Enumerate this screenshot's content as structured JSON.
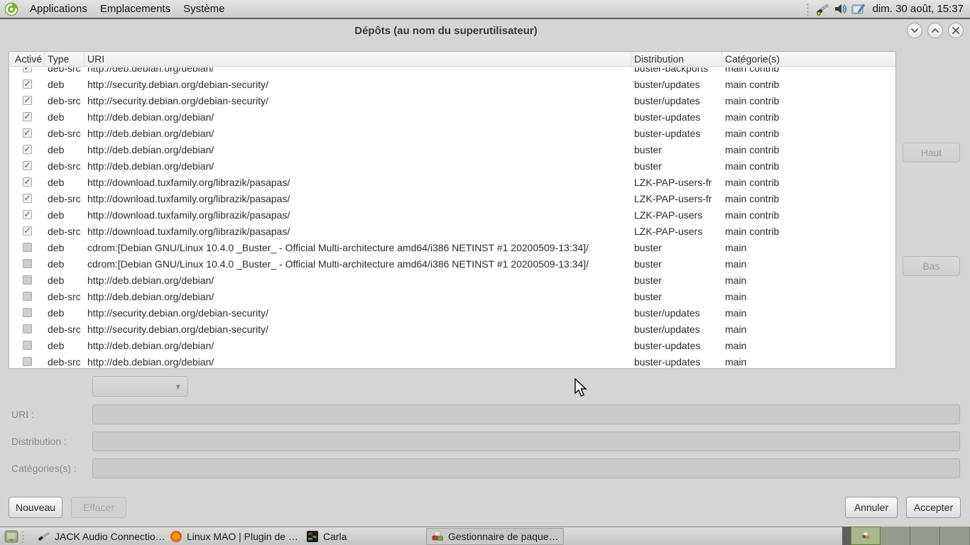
{
  "top_panel": {
    "menus": [
      {
        "label": "Applications"
      },
      {
        "label": "Emplacements"
      },
      {
        "label": "Système"
      }
    ],
    "clock": "dim. 30 août, 15:37"
  },
  "window": {
    "title": "Dépôts (au nom du superutilisateur)"
  },
  "table": {
    "columns": [
      "Activé",
      "Type",
      "URI",
      "Distribution",
      "Catégorie(s)"
    ],
    "rows": [
      {
        "enabled": true,
        "type": "deb-src",
        "uri": "http://deb.debian.org/debian/",
        "distribution": "buster-backports",
        "categories": "main contrib"
      },
      {
        "enabled": true,
        "type": "deb",
        "uri": "http://security.debian.org/debian-security/",
        "distribution": "buster/updates",
        "categories": "main contrib"
      },
      {
        "enabled": true,
        "type": "deb-src",
        "uri": "http://security.debian.org/debian-security/",
        "distribution": "buster/updates",
        "categories": "main contrib"
      },
      {
        "enabled": true,
        "type": "deb",
        "uri": "http://deb.debian.org/debian/",
        "distribution": "buster-updates",
        "categories": "main contrib"
      },
      {
        "enabled": true,
        "type": "deb-src",
        "uri": "http://deb.debian.org/debian/",
        "distribution": "buster-updates",
        "categories": "main contrib"
      },
      {
        "enabled": true,
        "type": "deb",
        "uri": "http://deb.debian.org/debian/",
        "distribution": "buster",
        "categories": "main contrib"
      },
      {
        "enabled": true,
        "type": "deb-src",
        "uri": "http://deb.debian.org/debian/",
        "distribution": "buster",
        "categories": "main contrib"
      },
      {
        "enabled": true,
        "type": "deb",
        "uri": "http://download.tuxfamily.org/librazik/pasapas/",
        "distribution": "LZK-PAP-users-fr",
        "categories": "main contrib"
      },
      {
        "enabled": true,
        "type": "deb-src",
        "uri": "http://download.tuxfamily.org/librazik/pasapas/",
        "distribution": "LZK-PAP-users-fr",
        "categories": "main contrib"
      },
      {
        "enabled": true,
        "type": "deb",
        "uri": "http://download.tuxfamily.org/librazik/pasapas/",
        "distribution": "LZK-PAP-users",
        "categories": "main contrib"
      },
      {
        "enabled": true,
        "type": "deb-src",
        "uri": "http://download.tuxfamily.org/librazik/pasapas/",
        "distribution": "LZK-PAP-users",
        "categories": "main contrib"
      },
      {
        "enabled": false,
        "type": "deb",
        "uri": "cdrom:[Debian GNU/Linux 10.4.0 _Buster_ - Official Multi-architecture amd64/i386 NETINST #1 20200509-13:34]/",
        "distribution": "buster",
        "categories": "main"
      },
      {
        "enabled": false,
        "type": "deb",
        "uri": "cdrom:[Debian GNU/Linux 10.4.0 _Buster_ - Official Multi-architecture amd64/i386 NETINST #1 20200509-13:34]/",
        "distribution": "buster",
        "categories": "main"
      },
      {
        "enabled": false,
        "type": "deb",
        "uri": "http://deb.debian.org/debian/",
        "distribution": "buster",
        "categories": "main"
      },
      {
        "enabled": false,
        "type": "deb-src",
        "uri": "http://deb.debian.org/debian/",
        "distribution": "buster",
        "categories": "main"
      },
      {
        "enabled": false,
        "type": "deb",
        "uri": "http://security.debian.org/debian-security/",
        "distribution": "buster/updates",
        "categories": "main"
      },
      {
        "enabled": false,
        "type": "deb-src",
        "uri": "http://security.debian.org/debian-security/",
        "distribution": "buster/updates",
        "categories": "main"
      },
      {
        "enabled": false,
        "type": "deb",
        "uri": "http://deb.debian.org/debian/",
        "distribution": "buster-updates",
        "categories": "main"
      },
      {
        "enabled": false,
        "type": "deb-src",
        "uri": "http://deb.debian.org/debian/",
        "distribution": "buster-updates",
        "categories": "main"
      }
    ]
  },
  "side_buttons": {
    "up": "Haut",
    "down": "Bas"
  },
  "form": {
    "uri_label": "URI :",
    "distribution_label": "Distribution :",
    "categories_label": "Catégories(s) :",
    "uri_value": "",
    "distribution_value": "",
    "categories_value": "",
    "type_selected": ""
  },
  "action_buttons": {
    "new": "Nouveau",
    "delete": "Effacer",
    "cancel": "Annuler",
    "accept": "Accepter"
  },
  "taskbar": {
    "items": [
      {
        "label": "JACK Audio Connectio…",
        "icon": "jack-icon"
      },
      {
        "label": "Linux MAO | Plugin de …",
        "icon": "firefox-icon"
      },
      {
        "label": "Carla",
        "icon": "carla-icon"
      },
      {
        "label": "Gestionnaire de paque…",
        "icon": "synaptic-icon",
        "active": true
      }
    ],
    "workspace_count": 4,
    "active_workspace": 1
  },
  "icons": {
    "check": "✓",
    "combo_arrow": "▾"
  },
  "colors": {
    "panel_bg": "#d6d5d3",
    "table_bg": "#ffffff",
    "check_green": "#6f9c3f",
    "workspace_active": "#a9b88f",
    "disabled_text": "#9c9c9a"
  }
}
